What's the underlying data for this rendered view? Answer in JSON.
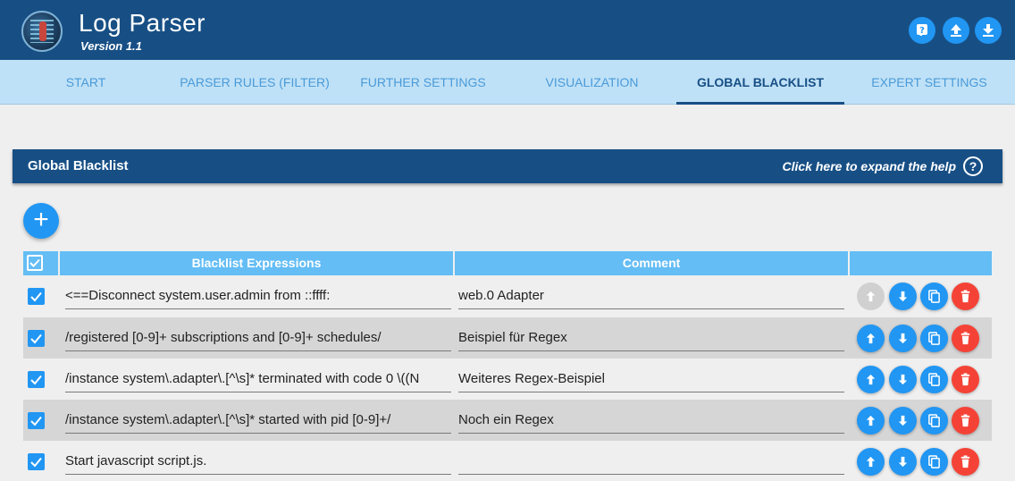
{
  "app": {
    "title": "Log Parser",
    "version": "Version 1.1"
  },
  "header_buttons": [
    {
      "name": "help-button",
      "icon": "question-icon"
    },
    {
      "name": "upload-button",
      "icon": "upload-icon"
    },
    {
      "name": "download-button",
      "icon": "download-icon"
    }
  ],
  "tabs": [
    {
      "label": "START",
      "active": false
    },
    {
      "label": "PARSER RULES (FILTER)",
      "active": false
    },
    {
      "label": "FURTHER SETTINGS",
      "active": false
    },
    {
      "label": "VISUALIZATION",
      "active": false
    },
    {
      "label": "GLOBAL BLACKLIST",
      "active": true
    },
    {
      "label": "EXPERT SETTINGS",
      "active": false
    }
  ],
  "section": {
    "title": "Global Blacklist",
    "help_link": "Click here to expand the help",
    "help_icon": "?"
  },
  "add_button": {
    "icon": "plus-icon",
    "label": "+"
  },
  "table": {
    "headers": {
      "expressions": "Blacklist Expressions",
      "comment": "Comment"
    },
    "rows": [
      {
        "checked": true,
        "expression": "<==Disconnect system.user.admin from ::ffff:",
        "comment": "web.0 Adapter",
        "up_enabled": false
      },
      {
        "checked": true,
        "expression": "/registered [0-9]+ subscriptions and [0-9]+ schedules/",
        "comment": "Beispiel für Regex",
        "up_enabled": true
      },
      {
        "checked": true,
        "expression": "/instance system\\.adapter\\.[^\\s]* terminated with code 0 \\((N",
        "comment": "Weiteres Regex-Beispiel",
        "up_enabled": true
      },
      {
        "checked": true,
        "expression": "/instance system\\.adapter\\.[^\\s]* started with pid [0-9]+/",
        "comment": "Noch ein Regex",
        "up_enabled": true
      },
      {
        "checked": true,
        "expression": "Start javascript script.js.",
        "comment": "",
        "up_enabled": true
      }
    ]
  },
  "colors": {
    "header": "#174f85",
    "tabs_bg": "#bfe1f7",
    "accent": "#2196f3",
    "delete": "#f44336",
    "table_header": "#64bdf5"
  }
}
